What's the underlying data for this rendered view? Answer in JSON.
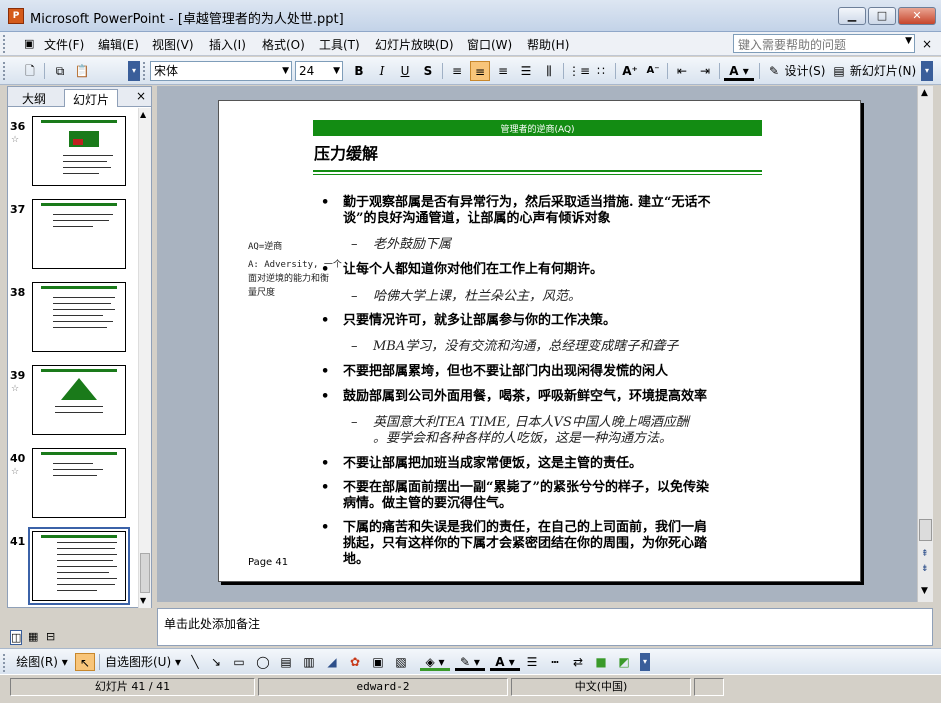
{
  "window": {
    "title": "Microsoft PowerPoint - [卓越管理者的为人处世.ppt]",
    "icon": "powerpoint-app-icon"
  },
  "menu": [
    "文件(F)",
    "编辑(E)",
    "视图(V)",
    "插入(I)",
    "格式(O)",
    "工具(T)",
    "幻灯片放映(D)",
    "窗口(W)",
    "帮助(H)"
  ],
  "help_placeholder": "键入需要帮助的问题",
  "format": {
    "font": "宋体",
    "size": "24",
    "design_label": "设计(S)",
    "new_slide_label": "新幻灯片(N)"
  },
  "panel": {
    "tab_outline": "大纲",
    "tab_slides": "幻灯片",
    "close": "×"
  },
  "thumbnails": [
    {
      "num": "36",
      "star": "☆"
    },
    {
      "num": "37",
      "star": ""
    },
    {
      "num": "38",
      "star": ""
    },
    {
      "num": "39",
      "star": "☆"
    },
    {
      "num": "40",
      "star": "☆"
    },
    {
      "num": "41",
      "star": ""
    }
  ],
  "slide": {
    "header": "管理者的逆商(AQ)",
    "title": "压力缓解",
    "note": [
      "AQ=逆商",
      "A: Adversity, 一个",
      "面对逆境的能力和衡",
      "量尺度"
    ],
    "page": "Page 41",
    "bullets": [
      {
        "kind": "b",
        "lines": [
          "勤于观察部属是否有异常行为，然后采取适当措施. 建立“无话不",
          "谈”的良好沟通管道，让部属的心声有倾诉对象"
        ]
      },
      {
        "kind": "s",
        "lines": [
          "老外鼓励下属"
        ]
      },
      {
        "kind": "b",
        "lines": [
          "让每个人都知道你对他们在工作上有何期许。"
        ]
      },
      {
        "kind": "s",
        "lines": [
          "哈佛大学上课，杜兰朵公主，风范。"
        ]
      },
      {
        "kind": "b",
        "lines": [
          "只要情况许可，就多让部属参与你的工作决策。"
        ]
      },
      {
        "kind": "s",
        "lines": [
          "MBA学习，没有交流和沟通，总经理变成瞎子和聋子"
        ]
      },
      {
        "kind": "b",
        "lines": [
          "不要把部属累垮，但也不要让部门内出现闲得发慌的闲人"
        ]
      },
      {
        "kind": "b",
        "lines": [
          "鼓励部属到公司外面用餐，喝茶，呼吸新鲜空气，环境提高效率"
        ]
      },
      {
        "kind": "s",
        "lines": [
          "英国意大利TEA TIME, 日本人VS中国人晚上喝酒应酬",
          "。要学会和各种各样的人吃饭，这是一种沟通方法。"
        ]
      },
      {
        "kind": "b",
        "lines": [
          "不要让部属把加班当成家常便饭，这是主管的责任。"
        ]
      },
      {
        "kind": "b",
        "lines": [
          "不要在部属面前摆出一副“累毙了”的紧张兮兮的样子，以免传染",
          "病情。做主管的要沉得住气。"
        ]
      },
      {
        "kind": "b",
        "lines": [
          "下属的痛苦和失误是我们的责任，在自己的上司面前，我们一肩",
          "挑起，只有这样你的下属才会紧密团结在你的周围，为你死心踏",
          "地。"
        ]
      }
    ]
  },
  "notes_placeholder": "单击此处添加备注",
  "drawing": {
    "draw_label": "绘图(R)",
    "autoshapes_label": "自选图形(U)"
  },
  "status": {
    "slide": "幻灯片 41 / 41",
    "design": "edward-2",
    "language": "中文(中国)"
  }
}
